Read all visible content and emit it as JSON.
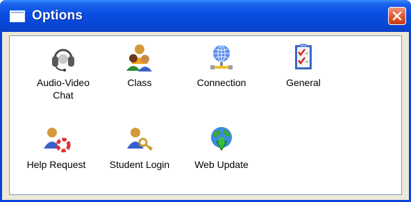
{
  "window": {
    "title": "Options",
    "close_icon": "close-icon"
  },
  "items": [
    {
      "label": "Audio-Video\nChat",
      "icon": "headset-icon"
    },
    {
      "label": "Class",
      "icon": "users-group-icon"
    },
    {
      "label": "Connection",
      "icon": "network-globe-icon"
    },
    {
      "label": "General",
      "icon": "checklist-icon"
    },
    {
      "label": "Help Request",
      "icon": "lifebuoy-user-icon"
    },
    {
      "label": "Student Login",
      "icon": "key-user-icon"
    },
    {
      "label": "Web Update",
      "icon": "globe-update-icon"
    }
  ]
}
